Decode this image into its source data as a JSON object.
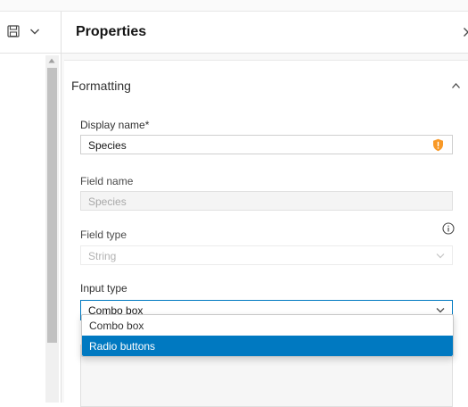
{
  "panel": {
    "title": "Properties"
  },
  "section": {
    "title": "Formatting"
  },
  "fields": {
    "display_name": {
      "label": "Display name*",
      "value": "Species"
    },
    "field_name": {
      "label": "Field name",
      "value": "Species"
    },
    "field_type": {
      "label": "Field type",
      "value": "String"
    },
    "input_type": {
      "label": "Input type",
      "value": "Combo box"
    }
  },
  "dropdown": {
    "options": [
      {
        "label": "Combo box",
        "selected": false
      },
      {
        "label": "Radio buttons",
        "selected": true
      }
    ]
  },
  "colors": {
    "accent": "#0079c1",
    "warning": "#f89927"
  },
  "icons": {
    "toolbar": [
      "save-icon",
      "chevron-down-icon"
    ],
    "panel": [
      "chevron-right-icon",
      "chevron-up-icon",
      "warning-shield-icon",
      "info-icon"
    ]
  }
}
